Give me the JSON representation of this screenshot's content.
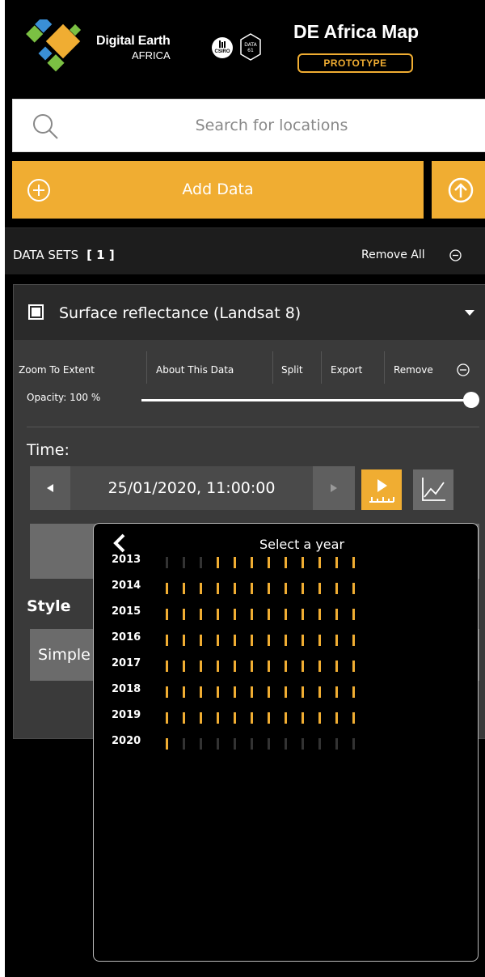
{
  "header": {
    "brand_line1": "Digital Earth",
    "brand_line2": "AFRICA",
    "partner1": "CSIRO",
    "partner2": "DATA 61",
    "app_title": "DE Africa Map",
    "badge": "PROTOTYPE"
  },
  "search": {
    "placeholder": "Search for locations"
  },
  "add_data": {
    "label": "Add Data"
  },
  "datasets": {
    "heading": "DATA SETS",
    "count": "[ 1 ]",
    "remove_all": "Remove All"
  },
  "dataset": {
    "title": "Surface reflectance (Landsat 8)",
    "actions": [
      "Zoom To Extent",
      "About This Data",
      "Split",
      "Export",
      "Remove"
    ],
    "opacity_label": "Opacity: 100 %",
    "opacity_fraction": 1.0,
    "time_label": "Time:",
    "time_value": "25/01/2020, 11:00:00",
    "style_label": "Style",
    "style_value": "Simple"
  },
  "picker": {
    "title": "Select a year",
    "years": [
      {
        "year": "2013",
        "months": [
          0,
          0,
          0,
          1,
          1,
          1,
          1,
          1,
          1,
          1,
          1,
          1
        ]
      },
      {
        "year": "2014",
        "months": [
          1,
          1,
          1,
          1,
          1,
          1,
          1,
          1,
          1,
          1,
          1,
          1
        ]
      },
      {
        "year": "2015",
        "months": [
          1,
          1,
          1,
          1,
          1,
          1,
          1,
          1,
          1,
          1,
          1,
          1
        ]
      },
      {
        "year": "2016",
        "months": [
          1,
          1,
          1,
          1,
          1,
          1,
          1,
          1,
          1,
          1,
          1,
          1
        ]
      },
      {
        "year": "2017",
        "months": [
          1,
          1,
          1,
          1,
          1,
          1,
          1,
          1,
          1,
          1,
          1,
          1
        ]
      },
      {
        "year": "2018",
        "months": [
          1,
          1,
          1,
          1,
          1,
          1,
          1,
          1,
          1,
          1,
          1,
          1
        ]
      },
      {
        "year": "2019",
        "months": [
          1,
          1,
          1,
          1,
          1,
          1,
          1,
          1,
          1,
          1,
          1,
          1
        ]
      },
      {
        "year": "2020",
        "months": [
          1,
          0,
          0,
          0,
          0,
          0,
          0,
          0,
          0,
          0,
          0,
          0
        ]
      }
    ]
  },
  "colors": {
    "accent": "#f0ad32",
    "panel": "#3a3a3a",
    "background": "#000000"
  }
}
